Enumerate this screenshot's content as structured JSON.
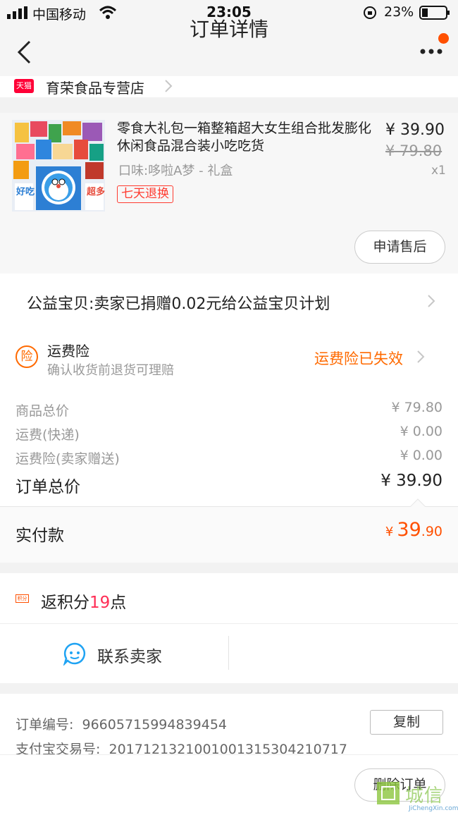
{
  "status_bar": {
    "carrier": "中国移动",
    "time": "23:05",
    "battery_percent": "23%"
  },
  "nav": {
    "title": "订单详情",
    "back_icon": "back-chevron-icon",
    "more_icon": "more-dots-icon",
    "notification_dot_color": "#ff5000"
  },
  "store": {
    "badge": "天猫",
    "name": "育荣食品专营店"
  },
  "product": {
    "title": "零食大礼包一箱整箱超大女生组合批发膨化休闲食品混合装小吃吃货",
    "variant": "口味:哆啦A梦 - 礼盒",
    "price": "¥ 39.90",
    "original_price": "¥ 79.80",
    "quantity": "x1",
    "return_tag": "七天退换",
    "aftersale_button": "申请售后",
    "image_text_1": "好吃",
    "image_text_2": "超多"
  },
  "charity": {
    "text": "公益宝贝:卖家已捐赠0.02元给公益宝贝计划"
  },
  "insurance": {
    "icon_text": "险",
    "title": "运费险",
    "subtitle": "确认收货前退货可理赔",
    "status": "运费险已失效"
  },
  "breakdown": {
    "items": [
      {
        "label": "商品总价",
        "value": "¥ 79.80"
      },
      {
        "label": "运费(快递)",
        "value": "¥ 0.00"
      },
      {
        "label": "运费险(卖家赠送)",
        "value": "¥ 0.00"
      }
    ],
    "total_label": "订单总价",
    "total_value": "¥ 39.90"
  },
  "paid": {
    "label": "实付款",
    "currency": "¥",
    "integer": "39",
    "decimal": ".90"
  },
  "points": {
    "badge": "积分",
    "prefix": "返积分",
    "count": "19",
    "suffix": "点"
  },
  "contact": {
    "label": "联系卖家"
  },
  "order_info": {
    "order_no_label": "订单编号:",
    "order_no": "966057159948394­54",
    "alipay_label": "支付宝交易号:",
    "alipay_no": "2017121321001001315304210717",
    "copy_button": "复制"
  },
  "bottom": {
    "delete_button": "删除订单"
  },
  "watermark": {
    "text": "城信",
    "url": "JiChengXin.com"
  },
  "colors": {
    "accent": "#ff5000",
    "tmall_red": "#ff0036",
    "insurance_orange": "#ff6a00"
  }
}
